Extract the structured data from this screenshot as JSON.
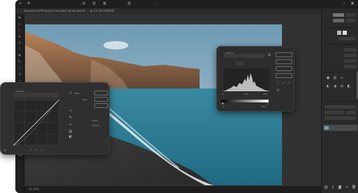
{
  "app": {
    "document_tab": "Seashore-cliffs-beach-sea-with-sandy-beach-... @ 33.3% (RGB/8)",
    "status_zoom": "33.33%"
  },
  "options_bar": {
    "icons": [
      "home-icon",
      "move-tool-icon",
      "align-left-icon",
      "align-center-icon",
      "align-right-icon",
      "distribute-icon",
      "more-icon"
    ]
  },
  "tools": {
    "icons": [
      "move-icon",
      "marquee-icon",
      "lasso-icon",
      "magic-wand-icon",
      "crop-icon",
      "eyedropper-icon",
      "healing-icon",
      "brush-icon",
      "stamp-icon",
      "history-brush-icon",
      "eraser-icon",
      "gradient-icon",
      "blur-icon",
      "dodge-icon",
      "pen-icon",
      "type-icon",
      "path-select-icon",
      "shape-icon",
      "hand-icon",
      "zoom-icon",
      "more-tools-icon",
      "color-swatch-icon"
    ]
  },
  "curves_panel": {
    "preset_label": "Custom",
    "channel_label": "RGB",
    "auto_label": "Auto",
    "input_label": "Input",
    "output_label": "Output"
  },
  "levels_panel": {
    "preset_label": "Default",
    "channel_label": "RGB",
    "input_low": "0",
    "input_mid": "1.00",
    "input_high": "255",
    "output_low": "0",
    "output_high": "255"
  },
  "colors": {
    "app_bg": "#262626",
    "panel_bg": "#2f2f2f",
    "accent": "#2f7bd8",
    "sea": "#2c8ba0",
    "sky": "#8fb6cc"
  }
}
